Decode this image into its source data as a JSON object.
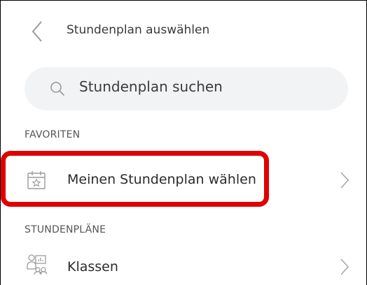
{
  "header": {
    "title": "Stundenplan auswählen",
    "back_icon": "chevron-left-icon"
  },
  "search": {
    "placeholder": "Stundenplan suchen",
    "icon": "search-icon"
  },
  "sections": {
    "favorites_label": "FAVORITEN",
    "timetables_label": "STUNDENPLÄNE"
  },
  "favorites": {
    "item_label": "Meinen Stundenplan wählen",
    "item_icon": "calendar-star-icon"
  },
  "timetables": {
    "item_label": "Klassen",
    "item_icon": "class-people-board-icon"
  },
  "colors": {
    "highlight": "#e00000",
    "search_bg": "#f1f3f4",
    "icon_gray": "#9a9a9a"
  }
}
